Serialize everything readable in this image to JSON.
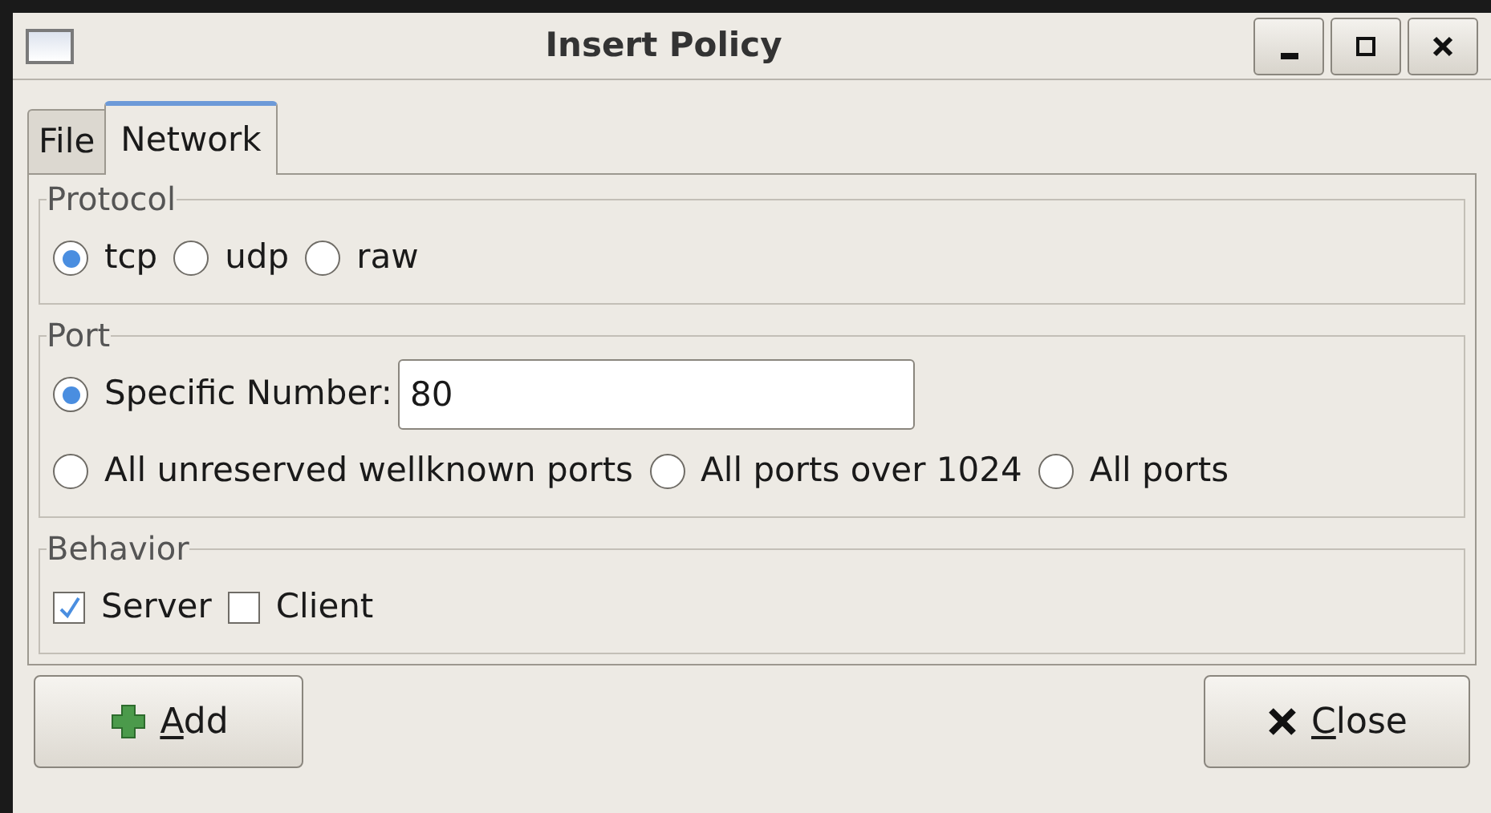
{
  "window": {
    "title": "Insert Policy"
  },
  "tabs": [
    {
      "label": "File",
      "selected": false
    },
    {
      "label": "Network",
      "selected": true
    }
  ],
  "groups": [
    {
      "title": "Protocol",
      "lines": [
        [
          {
            "kind": "radio",
            "label": "tcp",
            "selected": true
          },
          {
            "kind": "radio",
            "label": "udp",
            "selected": false
          },
          {
            "kind": "radio",
            "label": "raw",
            "selected": false
          }
        ]
      ]
    },
    {
      "title": "Port",
      "lines": [
        [
          {
            "kind": "radio",
            "label": "Specific Number:",
            "selected": true,
            "value": "80"
          }
        ],
        [
          {
            "kind": "radio",
            "label": "All unreserved wellknown ports",
            "selected": false
          },
          {
            "kind": "radio",
            "label": "All ports over 1024",
            "selected": false
          },
          {
            "kind": "radio",
            "label": "All ports",
            "selected": false
          }
        ]
      ]
    },
    {
      "title": "Behavior",
      "lines": [
        [
          {
            "kind": "checkbox",
            "label": "Server",
            "checked": true
          },
          {
            "kind": "checkbox",
            "label": "Client",
            "checked": false
          }
        ]
      ]
    }
  ],
  "buttons": [
    {
      "kind": "add",
      "label": "Add",
      "mnemonic": true
    },
    {
      "kind": "close",
      "label": "Close",
      "mnemonic": true
    }
  ]
}
